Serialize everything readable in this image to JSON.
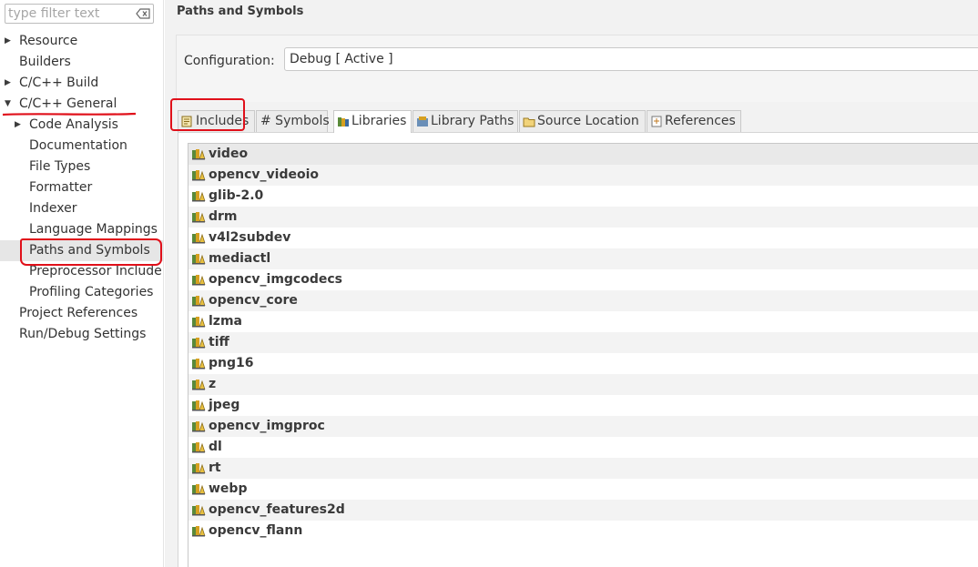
{
  "filter": {
    "placeholder": "type filter text"
  },
  "tree": [
    {
      "label": "Resource",
      "level": 0,
      "arrow": "collapsed"
    },
    {
      "label": "Builders",
      "level": 0,
      "arrow": "none"
    },
    {
      "label": "C/C++ Build",
      "level": 0,
      "arrow": "collapsed"
    },
    {
      "label": "C/C++ General",
      "level": 0,
      "arrow": "expanded"
    },
    {
      "label": "Code Analysis",
      "level": 1,
      "arrow": "collapsed"
    },
    {
      "label": "Documentation",
      "level": 1,
      "arrow": "none"
    },
    {
      "label": "File Types",
      "level": 1,
      "arrow": "none"
    },
    {
      "label": "Formatter",
      "level": 1,
      "arrow": "none"
    },
    {
      "label": "Indexer",
      "level": 1,
      "arrow": "none"
    },
    {
      "label": "Language Mappings",
      "level": 1,
      "arrow": "none"
    },
    {
      "label": "Paths and Symbols",
      "level": 1,
      "arrow": "none",
      "selected": true
    },
    {
      "label": "Preprocessor Include",
      "level": 1,
      "arrow": "none"
    },
    {
      "label": "Profiling Categories",
      "level": 1,
      "arrow": "none"
    },
    {
      "label": "Project References",
      "level": 0,
      "arrow": "none"
    },
    {
      "label": "Run/Debug Settings",
      "level": 0,
      "arrow": "none"
    }
  ],
  "page": {
    "title": "Paths and Symbols"
  },
  "config": {
    "label": "Configuration:",
    "value": "Debug  [ Active ]"
  },
  "tabs": [
    {
      "label": "Includes",
      "icon": "includes-icon"
    },
    {
      "label": "# Symbols",
      "icon": "none"
    },
    {
      "label": "Libraries",
      "icon": "library-icon",
      "active": true
    },
    {
      "label": "Library Paths",
      "icon": "library-path-icon"
    },
    {
      "label": "Source Location",
      "icon": "folder-icon"
    },
    {
      "label": "References",
      "icon": "references-icon"
    }
  ],
  "libraries": [
    "video",
    "opencv_videoio",
    "glib-2.0",
    "drm",
    "v4l2subdev",
    "mediactl",
    "opencv_imgcodecs",
    "opencv_core",
    "lzma",
    "tiff",
    "png16",
    "z",
    "jpeg",
    "opencv_imgproc",
    "dl",
    "rt",
    "webp",
    "opencv_features2d",
    "opencv_flann"
  ],
  "colors": {
    "annotation": "#e0101a",
    "selected_row": "#e6e6e6"
  }
}
